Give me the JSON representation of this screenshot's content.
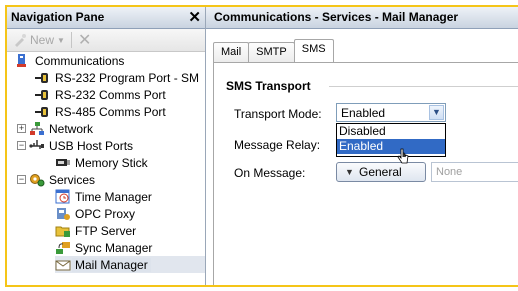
{
  "nav": {
    "title": "Navigation Pane",
    "close_glyph": "✕",
    "toolbar": {
      "new_label": "New",
      "delete_glyph": "✕"
    },
    "tree": [
      {
        "label": "Communications",
        "icon": "communications-icon",
        "expander": ""
      },
      {
        "label": "RS-232 Program Port - SM",
        "icon": "serial-port-icon",
        "expander": ""
      },
      {
        "label": "RS-232 Comms Port",
        "icon": "serial-port-icon",
        "expander": ""
      },
      {
        "label": "RS-485 Comms Port",
        "icon": "serial-port-icon",
        "expander": ""
      },
      {
        "label": "Network",
        "icon": "network-icon",
        "expander": "+"
      },
      {
        "label": "USB Host Ports",
        "icon": "usb-icon",
        "expander": "−"
      },
      {
        "label": "Memory Stick",
        "icon": "memory-stick-icon",
        "expander": ""
      },
      {
        "label": "Services",
        "icon": "services-icon",
        "expander": "−"
      },
      {
        "label": "Time Manager",
        "icon": "time-manager-icon",
        "expander": ""
      },
      {
        "label": "OPC Proxy",
        "icon": "opc-proxy-icon",
        "expander": ""
      },
      {
        "label": "FTP Server",
        "icon": "ftp-server-icon",
        "expander": ""
      },
      {
        "label": "Sync Manager",
        "icon": "sync-manager-icon",
        "expander": ""
      },
      {
        "label": "Mail Manager",
        "icon": "mail-manager-icon",
        "expander": ""
      }
    ]
  },
  "main": {
    "title": "Communications - Services - Mail Manager",
    "tabs": [
      "Mail",
      "SMTP",
      "SMS"
    ],
    "active_tab": "SMS",
    "group_title": "SMS Transport",
    "transport_mode": {
      "label": "Transport Mode:",
      "value": "Enabled",
      "options": [
        "Disabled",
        "Enabled"
      ],
      "highlighted": "Enabled"
    },
    "message_relay": {
      "label": "Message Relay:"
    },
    "on_message": {
      "label": "On Message:",
      "button": "General",
      "placeholder": "None"
    }
  },
  "colors": {
    "frame_border": "#f5c518",
    "selection": "#316ac5",
    "header_gradient_bottom": "#c9d3e0"
  }
}
